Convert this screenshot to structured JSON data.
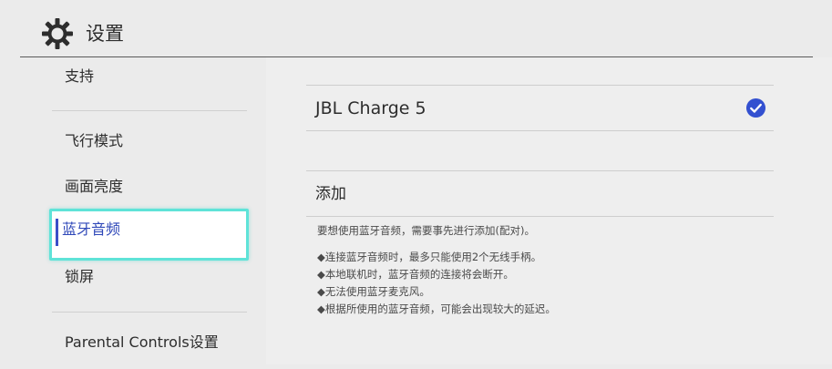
{
  "header": {
    "title": "设置",
    "icon": "gear-icon"
  },
  "sidebar": {
    "items": [
      {
        "label": "支持",
        "selected": false
      },
      {
        "label": "飞行模式",
        "selected": false
      },
      {
        "label": "画面亮度",
        "selected": false
      },
      {
        "label": "蓝牙音频",
        "selected": true
      },
      {
        "label": "锁屏",
        "selected": false
      },
      {
        "label": "Parental Controls设置",
        "selected": false
      }
    ]
  },
  "main": {
    "paired_device": {
      "name": "JBL Charge 5",
      "status_icon": "check-circle-icon",
      "connected": true
    },
    "add_label": "添加",
    "intro": "要想使用蓝牙音频，需要事先进行添加(配对)。",
    "notes": [
      "◆连接蓝牙音频时，最多只能使用2个无线手柄。",
      "◆本地联机时，蓝牙音频的连接将会断开。",
      "◆无法使用蓝牙麦克风。",
      "◆根据所使用的蓝牙音频，可能会出现较大的延迟。"
    ]
  },
  "colors": {
    "background": "#ebebeb",
    "accent_blue": "#2e47b8",
    "check_blue": "#3350d0",
    "selection_border": "#5fe3d8"
  }
}
